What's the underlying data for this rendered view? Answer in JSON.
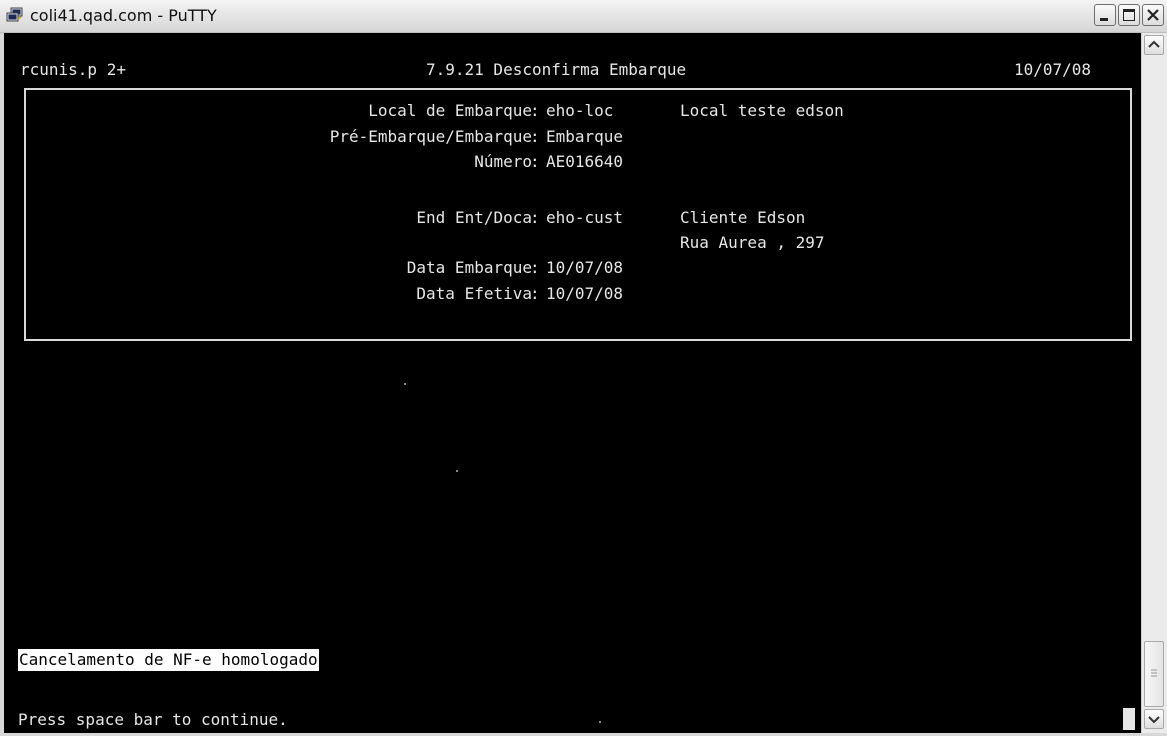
{
  "window": {
    "title": "coli41.qad.com - PuTTY",
    "icon": "putty-terminal-icon",
    "controls": [
      "minimize-icon",
      "maximize-icon",
      "close-icon"
    ]
  },
  "terminal": {
    "header": {
      "program": "rcunis.p 2+",
      "menu": "7.9.21 Desconfirma Embarque",
      "date": "10/07/08"
    },
    "fields": [
      {
        "label": "Local de Embarque",
        "value": "eho-loc",
        "description": "Local teste edson"
      },
      {
        "label": "Pré-Embarque/Embarque",
        "value": "Embarque",
        "description": ""
      },
      {
        "label": "Número",
        "value": "AE016640",
        "description": ""
      },
      {
        "label": "End Ent/Doca",
        "value": "eho-cust",
        "description": "Cliente Edson"
      },
      {
        "label": "",
        "value": "",
        "description": "Rua Aurea , 297"
      },
      {
        "label": "Data Embarque",
        "value": "10/07/08",
        "description": ""
      },
      {
        "label": "Data Efetiva",
        "value": "10/07/08",
        "description": ""
      }
    ],
    "status_message": "Cancelamento de NF-e homologado",
    "prompt": "Press space bar to continue."
  },
  "colors": {
    "terminal_bg": "#000000",
    "terminal_fg": "#e6e6e6",
    "status_bg": "#ffffff",
    "status_fg": "#000000"
  }
}
